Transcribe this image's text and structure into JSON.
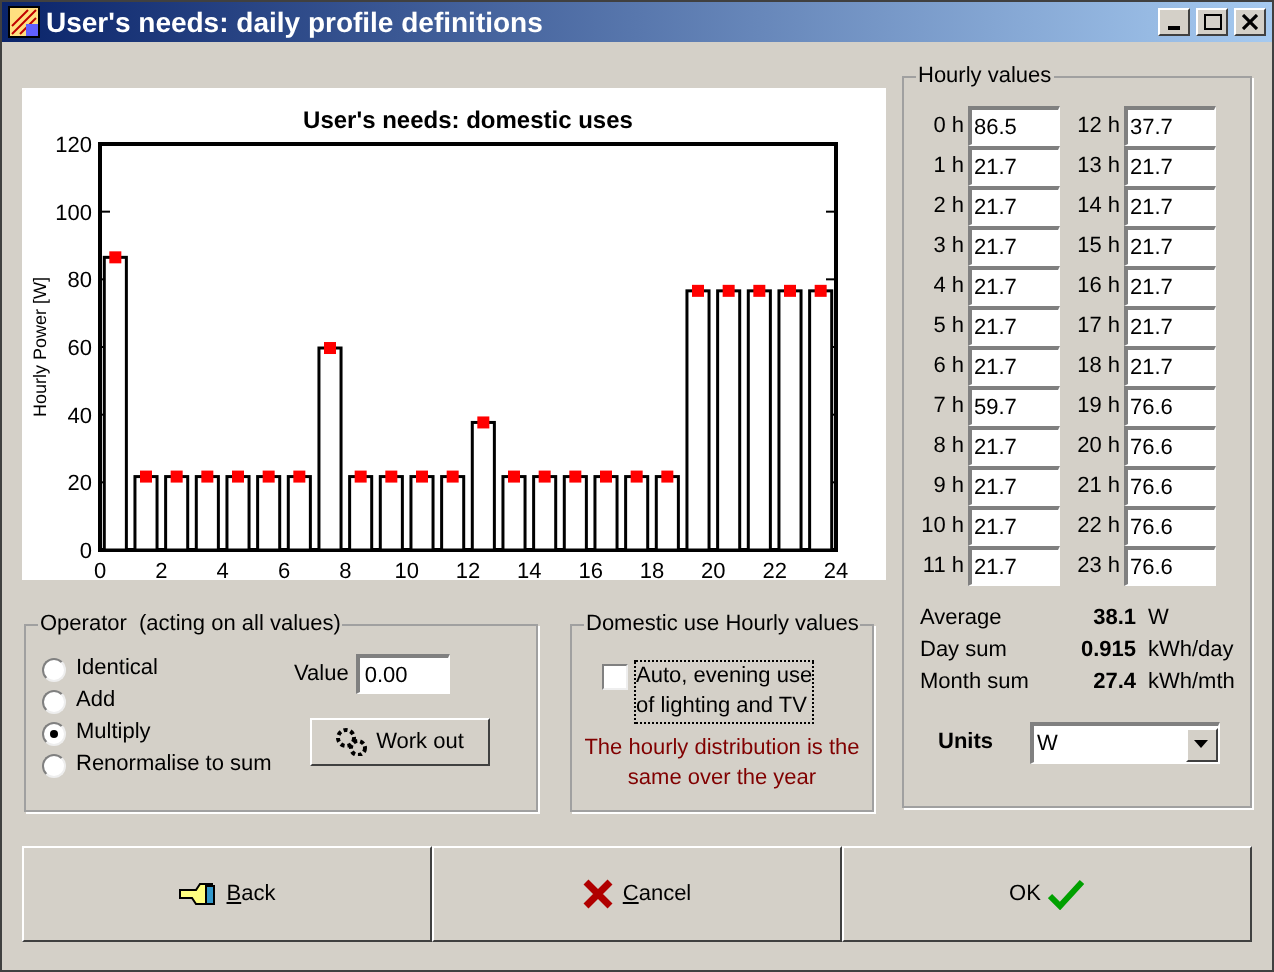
{
  "window": {
    "title": "User's needs: daily profile definitions"
  },
  "chart": {
    "chart_data": {
      "type": "bar",
      "title": "User's needs: domestic uses",
      "ylabel": "Hourly Power [W]",
      "x": [
        0.5,
        1.5,
        2.5,
        3.5,
        4.5,
        5.5,
        6.5,
        7.5,
        8.5,
        9.5,
        10.5,
        11.5,
        12.5,
        13.5,
        14.5,
        15.5,
        16.5,
        17.5,
        18.5,
        19.5,
        20.5,
        21.5,
        22.5,
        23.5
      ],
      "series": [
        {
          "type": "bar",
          "color": "#ffffff",
          "values": [
            86.5,
            21.7,
            21.7,
            21.7,
            21.7,
            21.7,
            21.7,
            59.7,
            21.7,
            21.7,
            21.7,
            21.7,
            37.7,
            21.7,
            21.7,
            21.7,
            21.7,
            21.7,
            21.7,
            76.6,
            76.6,
            76.6,
            76.6,
            76.6
          ]
        },
        {
          "type": "scatter",
          "color": "#ff0000",
          "values": [
            86.5,
            21.7,
            21.7,
            21.7,
            21.7,
            21.7,
            21.7,
            59.7,
            21.7,
            21.7,
            21.7,
            21.7,
            37.7,
            21.7,
            21.7,
            21.7,
            21.7,
            21.7,
            21.7,
            76.6,
            76.6,
            76.6,
            76.6,
            76.6
          ]
        }
      ],
      "xlim": [
        0,
        24
      ],
      "ylim": [
        0,
        120
      ],
      "xticks": [
        0,
        2,
        4,
        6,
        8,
        10,
        12,
        14,
        16,
        18,
        20,
        22,
        24
      ],
      "yticks": [
        0,
        20,
        40,
        60,
        80,
        100,
        120
      ]
    }
  },
  "hourly_values": {
    "title": "Hourly values",
    "hours": [
      {
        "label": "0 h",
        "value": "86.5"
      },
      {
        "label": "1 h",
        "value": "21.7"
      },
      {
        "label": "2 h",
        "value": "21.7"
      },
      {
        "label": "3 h",
        "value": "21.7"
      },
      {
        "label": "4 h",
        "value": "21.7"
      },
      {
        "label": "5 h",
        "value": "21.7"
      },
      {
        "label": "6 h",
        "value": "21.7"
      },
      {
        "label": "7 h",
        "value": "59.7"
      },
      {
        "label": "8 h",
        "value": "21.7"
      },
      {
        "label": "9 h",
        "value": "21.7"
      },
      {
        "label": "10 h",
        "value": "21.7"
      },
      {
        "label": "11 h",
        "value": "21.7"
      },
      {
        "label": "12 h",
        "value": "37.7"
      },
      {
        "label": "13 h",
        "value": "21.7"
      },
      {
        "label": "14 h",
        "value": "21.7"
      },
      {
        "label": "15 h",
        "value": "21.7"
      },
      {
        "label": "16 h",
        "value": "21.7"
      },
      {
        "label": "17 h",
        "value": "21.7"
      },
      {
        "label": "18 h",
        "value": "21.7"
      },
      {
        "label": "19 h",
        "value": "76.6"
      },
      {
        "label": "20 h",
        "value": "76.6"
      },
      {
        "label": "21 h",
        "value": "76.6"
      },
      {
        "label": "22 h",
        "value": "76.6"
      },
      {
        "label": "23 h",
        "value": "76.6"
      }
    ],
    "stats": [
      {
        "label": "Average",
        "value": "38.1",
        "unit": "W"
      },
      {
        "label": "Day sum",
        "value": "0.915",
        "unit": "kWh/day"
      },
      {
        "label": "Month sum",
        "value": "27.4",
        "unit": "kWh/mth"
      }
    ],
    "units": {
      "label": "Units",
      "value": "W"
    }
  },
  "operator": {
    "title": "Operator  (acting on all values)",
    "options": [
      {
        "label": "Identical",
        "selected": false
      },
      {
        "label": "Add",
        "selected": false
      },
      {
        "label": "Multiply",
        "selected": true
      },
      {
        "label": "Renormalise to sum",
        "selected": false
      }
    ],
    "value_label": "Value",
    "value": "0.00",
    "work_out": "Work out"
  },
  "domestic": {
    "title": "Domestic use Hourly values",
    "auto_lines": [
      "Auto, evening use",
      "of lighting and TV"
    ],
    "auto_checked": false,
    "note": "The hourly distribution is the same over the year"
  },
  "buttons": [
    {
      "kind": "back",
      "label": "Back",
      "mnemonic": true
    },
    {
      "kind": "cancel",
      "label": "Cancel",
      "mnemonic": true
    },
    {
      "kind": "ok",
      "label": "OK",
      "mnemonic": false
    }
  ]
}
